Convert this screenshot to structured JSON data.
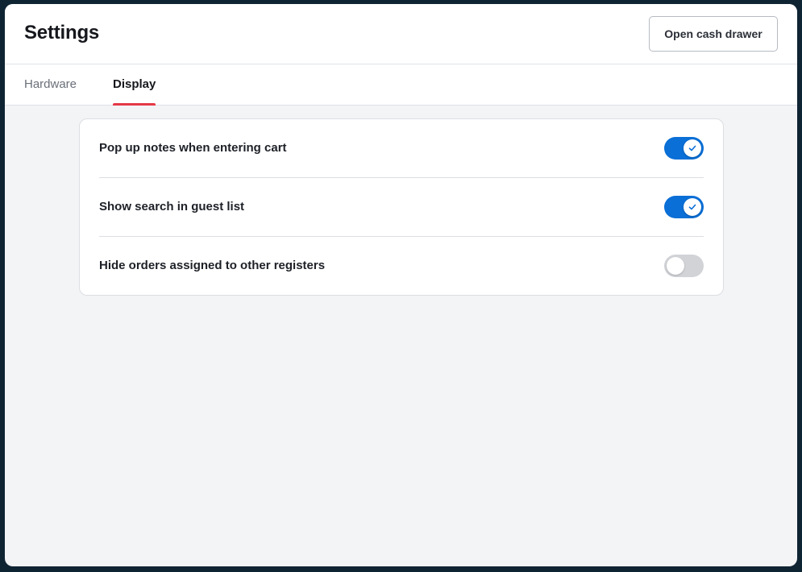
{
  "header": {
    "title": "Settings",
    "open_cash_drawer_label": "Open cash drawer"
  },
  "tabs": [
    {
      "label": "Hardware",
      "active": false
    },
    {
      "label": "Display",
      "active": true
    }
  ],
  "settings": [
    {
      "label": "Pop up notes when entering cart",
      "enabled": true
    },
    {
      "label": "Show search in guest list",
      "enabled": true
    },
    {
      "label": "Hide orders assigned to other registers",
      "enabled": false
    }
  ],
  "colors": {
    "accent": "#0a6fd6",
    "active_tab_underline": "#e53946",
    "toggle_off": "#d1d3d7"
  }
}
